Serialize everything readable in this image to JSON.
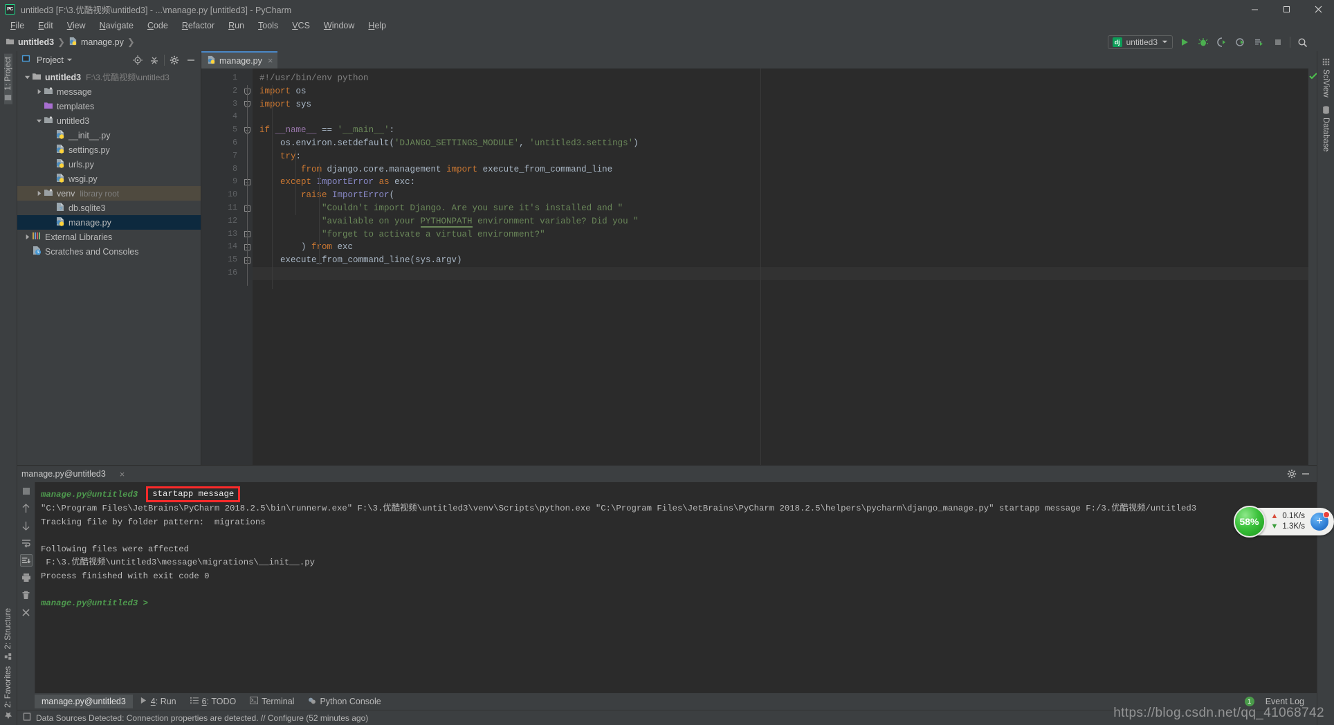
{
  "window": {
    "title": "untitled3 [F:\\3.优酷视频\\untitled3] - ...\\manage.py [untitled3] - PyCharm",
    "logo": "PC",
    "minimize": "minimize-icon",
    "maximize": "maximize-icon",
    "close": "close-icon"
  },
  "menu": {
    "items": [
      "File",
      "Edit",
      "View",
      "Navigate",
      "Code",
      "Refactor",
      "Run",
      "Tools",
      "VCS",
      "Window",
      "Help"
    ]
  },
  "breadcrumb": {
    "project": "untitled3",
    "file": "manage.py"
  },
  "toolbar": {
    "run_config": "untitled3",
    "run_config_badge": "dj",
    "icons": [
      "run-icon",
      "debug-icon",
      "coverage-icon",
      "profile-icon",
      "run-with-console-icon",
      "stop-icon",
      "search-everywhere-icon"
    ]
  },
  "project_panel": {
    "title": "Project",
    "header_icons": [
      "locate-icon",
      "collapse-all-icon",
      "settings-gear-icon",
      "hide-icon"
    ],
    "tree": [
      {
        "label": "untitled3",
        "sub": "F:\\3.优酷视频\\untitled3",
        "depth": 0,
        "icon": "folder-icon",
        "twist": "open",
        "bold": true,
        "state": ""
      },
      {
        "label": "message",
        "sub": "",
        "depth": 1,
        "icon": "module-folder-icon",
        "twist": "closed",
        "bold": false,
        "state": ""
      },
      {
        "label": "templates",
        "sub": "",
        "depth": 1,
        "icon": "templates-folder-icon",
        "twist": "none",
        "bold": false,
        "state": ""
      },
      {
        "label": "untitled3",
        "sub": "",
        "depth": 1,
        "icon": "module-folder-icon",
        "twist": "open",
        "bold": false,
        "state": ""
      },
      {
        "label": "__init__.py",
        "sub": "",
        "depth": 2,
        "icon": "python-file-icon",
        "twist": "none",
        "bold": false,
        "state": ""
      },
      {
        "label": "settings.py",
        "sub": "",
        "depth": 2,
        "icon": "python-file-icon",
        "twist": "none",
        "bold": false,
        "state": ""
      },
      {
        "label": "urls.py",
        "sub": "",
        "depth": 2,
        "icon": "python-file-icon",
        "twist": "none",
        "bold": false,
        "state": ""
      },
      {
        "label": "wsgi.py",
        "sub": "",
        "depth": 2,
        "icon": "python-file-icon",
        "twist": "none",
        "bold": false,
        "state": ""
      },
      {
        "label": "venv",
        "sub": "library root",
        "depth": 1,
        "icon": "module-folder-icon",
        "twist": "closed",
        "bold": false,
        "state": "hovered"
      },
      {
        "label": "db.sqlite3",
        "sub": "",
        "depth": 2,
        "icon": "sqlite-file-icon",
        "twist": "none",
        "bold": false,
        "state": ""
      },
      {
        "label": "manage.py",
        "sub": "",
        "depth": 2,
        "icon": "python-file-icon",
        "twist": "none",
        "bold": false,
        "state": "selected"
      },
      {
        "label": "External Libraries",
        "sub": "",
        "depth": 0,
        "icon": "libraries-icon",
        "twist": "closed",
        "bold": false,
        "state": ""
      },
      {
        "label": "Scratches and Consoles",
        "sub": "",
        "depth": 0,
        "icon": "scratches-icon",
        "twist": "none",
        "bold": false,
        "state": ""
      }
    ]
  },
  "editor": {
    "tab": {
      "label": "manage.py",
      "close": "×",
      "icon": "python-file-icon"
    },
    "line_numbers": [
      "1",
      "2",
      "3",
      "4",
      "5",
      "6",
      "7",
      "8",
      "9",
      "10",
      "11",
      "12",
      "13",
      "14",
      "15",
      "16"
    ],
    "lines": [
      "#!/usr/bin/env python",
      "import os",
      "import sys",
      "",
      "if __name__ == '__main__':",
      "    os.environ.setdefault('DJANGO_SETTINGS_MODULE', 'untitled3.settings')",
      "    try:",
      "        from django.core.management import execute_from_command_line",
      "    except ImportError as exc:",
      "        raise ImportError(",
      "            \"Couldn't import Django. Are you sure it's installed and \"",
      "            \"available on your PYTHONPATH environment variable? Did you \"",
      "            \"forget to activate a virtual environment?\"",
      "        ) from exc",
      "    execute_from_command_line(sys.argv)",
      ""
    ],
    "inspection_status": "ok-check-icon"
  },
  "console": {
    "tab_title": "manage.py@untitled3",
    "close": "×",
    "settings_icon": "gear-icon",
    "hide_icon": "hide-icon",
    "tool_icons": [
      "stop-icon",
      "up-arrow-icon",
      "down-arrow-icon",
      "soft-wrap-icon",
      "scroll-to-end-icon",
      "print-icon",
      "trash-icon",
      "close-icon"
    ],
    "prompt_label": "manage.py@untitled3",
    "command": "startapp message",
    "annotation_color": "#ff2a2a",
    "output_lines": [
      "\"C:\\Program Files\\JetBrains\\PyCharm 2018.2.5\\bin\\runnerw.exe\" F:\\3.优酷视频\\untitled3\\venv\\Scripts\\python.exe \"C:\\Program Files\\JetBrains\\PyCharm 2018.2.5\\helpers\\pycharm\\django_manage.py\" startapp message F:/3.优酷视频/untitled3",
      "Tracking file by folder pattern:  migrations",
      "",
      "Following files were affected",
      " F:\\3.优酷视频\\untitled3\\message\\migrations\\__init__.py",
      "Process finished with exit code 0",
      ""
    ],
    "final_prompt": "manage.py@untitled3",
    "final_prompt_arrow": ">"
  },
  "left_tabs": [
    {
      "label": "1: Project",
      "icon": "project-icon",
      "active": true
    },
    {
      "label": "2: Structure",
      "icon": "structure-icon",
      "active": false
    },
    {
      "label": "2: Favorites",
      "icon": "star-icon",
      "active": false
    }
  ],
  "right_tabs": [
    {
      "label": "SciView",
      "icon": "sciview-grid-icon"
    },
    {
      "label": "Database",
      "icon": "database-icon"
    }
  ],
  "bottom_tabs": [
    {
      "label": "manage.py@untitled3",
      "icon": "",
      "active": true
    },
    {
      "label": "4: Run",
      "icon": "run-icon",
      "active": false
    },
    {
      "label": "6: TODO",
      "icon": "todo-icon",
      "active": false
    },
    {
      "label": "Terminal",
      "icon": "terminal-icon",
      "active": false
    },
    {
      "label": "Python Console",
      "icon": "python-console-icon",
      "active": false
    }
  ],
  "event_log": {
    "label": "Event Log",
    "count": "1"
  },
  "statusbar": {
    "icon": "notification-icon",
    "text": "Data Sources Detected: Connection properties are detected. // Configure (52 minutes ago)"
  },
  "net_widget": {
    "percent": "58%",
    "upload": "0.1K/s",
    "download": "1.3K/s",
    "up_icon": "upload-arrow-icon",
    "down_icon": "download-arrow-icon",
    "plus_icon": "plus-icon"
  },
  "watermark": {
    "url": "https://blog.csdn.net/qq_41068742"
  },
  "colors": {
    "accent": "#4a88c7",
    "selection": "#0d293e",
    "hover": "#4f4a3f",
    "keyword": "#cc7832",
    "string": "#6a8759",
    "editor_bg": "#2b2b2b",
    "panel_bg": "#3c3f41",
    "annotation": "#ff2a2a",
    "django_green": "#0c9d58"
  }
}
